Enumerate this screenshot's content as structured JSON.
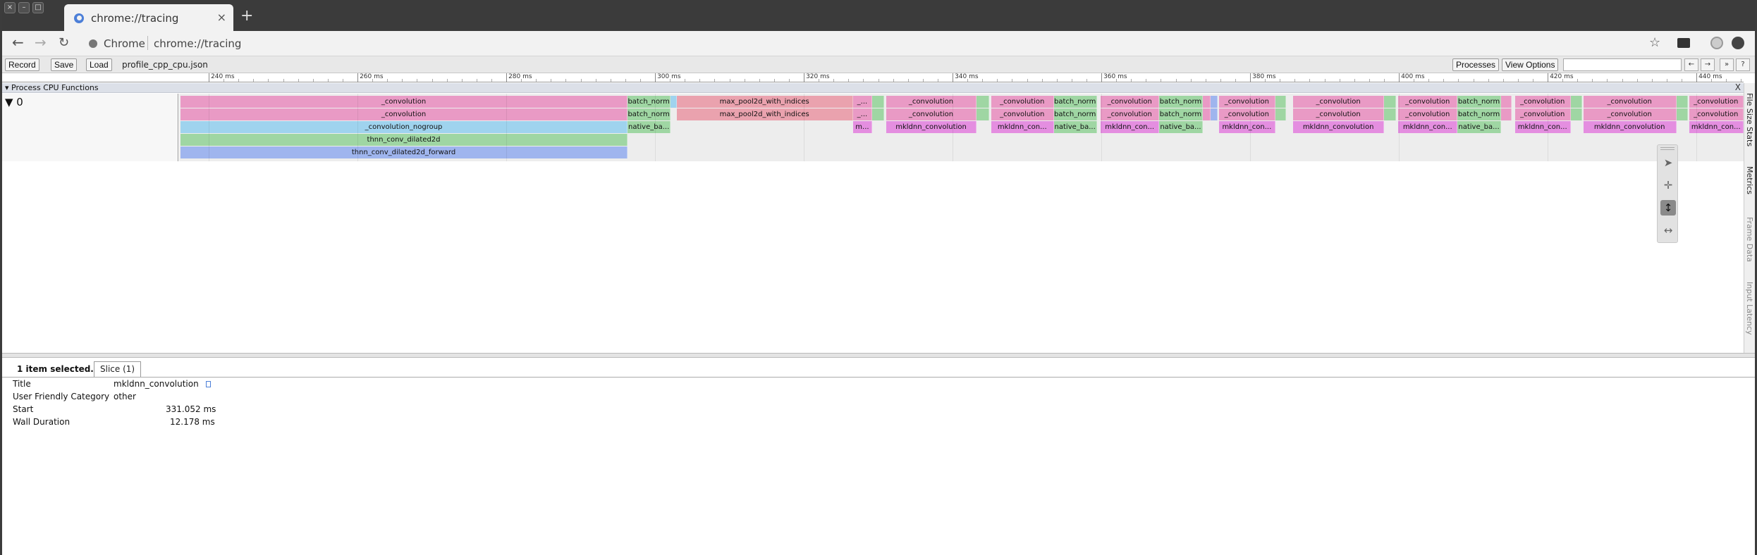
{
  "browser": {
    "tab_title": "chrome://tracing",
    "new_tab_label": "+",
    "tab_close_label": "×",
    "site_label": "Chrome",
    "url": "chrome://tracing",
    "window_buttons": [
      "×",
      "–",
      "□"
    ]
  },
  "toolbar": {
    "record": "Record",
    "save": "Save",
    "load": "Load",
    "filename": "profile_cpp_cpu.json",
    "processes": "Processes",
    "view_options": "View Options",
    "search_placeholder": "",
    "search_prev": "←",
    "search_next": "→",
    "search_all": "»",
    "help": "?"
  },
  "timeline": {
    "ticks": [
      "240 ms",
      "260 ms",
      "280 ms",
      "300 ms",
      "320 ms",
      "340 ms",
      "360 ms",
      "380 ms",
      "400 ms",
      "420 ms",
      "440 ms"
    ],
    "process_header": "▾ Process CPU Functions",
    "process_close": "X",
    "thread_label": "▼  0",
    "slices": [
      {
        "label": "_convolution",
        "start": 236.2,
        "end": 296.3,
        "row": 0,
        "color": "#e99ac5"
      },
      {
        "label": "_convolution",
        "start": 236.2,
        "end": 296.3,
        "row": 1,
        "color": "#e99ac5"
      },
      {
        "label": "_convolution_nogroup",
        "start": 236.2,
        "end": 296.3,
        "row": 2,
        "color": "#9fd3ee"
      },
      {
        "label": "thnn_conv_dilated2d",
        "start": 236.2,
        "end": 296.3,
        "row": 3,
        "color": "#9fd6a3"
      },
      {
        "label": "thnn_conv_dilated2d_forward",
        "start": 236.2,
        "end": 296.3,
        "row": 4,
        "color": "#9fb5ee"
      },
      {
        "label": "batch_norm",
        "start": 296.3,
        "end": 302.1,
        "row": 0,
        "color": "#9fd6a3"
      },
      {
        "label": "batch_norm",
        "start": 296.3,
        "end": 302.1,
        "row": 1,
        "color": "#9fd6a3"
      },
      {
        "label": "native_ba...",
        "start": 296.3,
        "end": 302.1,
        "row": 2,
        "color": "#9fd6a3"
      },
      {
        "label": "",
        "start": 302.1,
        "end": 302.9,
        "row": 0,
        "color": "#9fd3ee"
      },
      {
        "label": "max_pool2d_with_indices",
        "start": 302.9,
        "end": 326.6,
        "row": 0,
        "color": "#eaa2ae"
      },
      {
        "label": "max_pool2d_with_indices",
        "start": 302.9,
        "end": 326.6,
        "row": 1,
        "color": "#eaa2ae"
      },
      {
        "label": "_...",
        "start": 326.6,
        "end": 329.2,
        "row": 0,
        "color": "#e99ac5"
      },
      {
        "label": "_...",
        "start": 326.6,
        "end": 329.2,
        "row": 1,
        "color": "#e99ac5"
      },
      {
        "label": "m...",
        "start": 326.6,
        "end": 329.2,
        "row": 2,
        "color": "#e48ee0"
      },
      {
        "label": "",
        "start": 329.2,
        "end": 330.8,
        "row": 0,
        "color": "#9fd6a3"
      },
      {
        "label": "",
        "start": 329.2,
        "end": 330.8,
        "row": 1,
        "color": "#9fd6a3"
      },
      {
        "label": "_convolution",
        "start": 331.1,
        "end": 343.2,
        "row": 0,
        "color": "#e99ac5"
      },
      {
        "label": "_convolution",
        "start": 331.1,
        "end": 343.2,
        "row": 1,
        "color": "#e99ac5"
      },
      {
        "label": "mkldnn_convolution",
        "start": 331.1,
        "end": 343.2,
        "row": 2,
        "color": "#e48ee0"
      },
      {
        "label": "",
        "start": 343.2,
        "end": 344.9,
        "row": 0,
        "color": "#9fd6a3"
      },
      {
        "label": "",
        "start": 343.2,
        "end": 344.9,
        "row": 1,
        "color": "#9fd6a3"
      },
      {
        "label": "_convolution",
        "start": 345.2,
        "end": 353.6,
        "row": 0,
        "color": "#e99ac5"
      },
      {
        "label": "_convolution",
        "start": 345.2,
        "end": 353.6,
        "row": 1,
        "color": "#e99ac5"
      },
      {
        "label": "mkldnn_con...",
        "start": 345.2,
        "end": 353.6,
        "row": 2,
        "color": "#e48ee0"
      },
      {
        "label": "batch_norm",
        "start": 353.6,
        "end": 359.4,
        "row": 0,
        "color": "#9fd6a3"
      },
      {
        "label": "batch_norm",
        "start": 353.6,
        "end": 359.4,
        "row": 1,
        "color": "#9fd6a3"
      },
      {
        "label": "native_ba...",
        "start": 353.6,
        "end": 359.4,
        "row": 2,
        "color": "#9fd6a3"
      },
      {
        "label": "_convolution",
        "start": 359.9,
        "end": 367.8,
        "row": 0,
        "color": "#e99ac5"
      },
      {
        "label": "_convolution",
        "start": 359.9,
        "end": 367.8,
        "row": 1,
        "color": "#e99ac5"
      },
      {
        "label": "mkldnn_con...",
        "start": 359.9,
        "end": 367.8,
        "row": 2,
        "color": "#e48ee0"
      },
      {
        "label": "batch_norm",
        "start": 367.8,
        "end": 373.6,
        "row": 0,
        "color": "#9fd6a3"
      },
      {
        "label": "batch_norm",
        "start": 367.8,
        "end": 373.6,
        "row": 1,
        "color": "#9fd6a3"
      },
      {
        "label": "native_ba...",
        "start": 367.8,
        "end": 373.6,
        "row": 2,
        "color": "#9fd6a3"
      },
      {
        "label": "",
        "start": 373.6,
        "end": 374.7,
        "row": 0,
        "color": "#e99ac5"
      },
      {
        "label": "",
        "start": 373.6,
        "end": 374.7,
        "row": 1,
        "color": "#e99ac5"
      },
      {
        "label": "",
        "start": 374.7,
        "end": 375.6,
        "row": 0,
        "color": "#9fb5ee"
      },
      {
        "label": "",
        "start": 374.7,
        "end": 375.6,
        "row": 1,
        "color": "#9fb5ee"
      },
      {
        "label": "_convolution",
        "start": 375.8,
        "end": 383.4,
        "row": 0,
        "color": "#e99ac5"
      },
      {
        "label": "_convolution",
        "start": 375.8,
        "end": 383.4,
        "row": 1,
        "color": "#e99ac5"
      },
      {
        "label": "mkldnn_con...",
        "start": 375.8,
        "end": 383.4,
        "row": 2,
        "color": "#e48ee0"
      },
      {
        "label": "",
        "start": 383.4,
        "end": 384.8,
        "row": 0,
        "color": "#9fd6a3"
      },
      {
        "label": "",
        "start": 383.4,
        "end": 384.8,
        "row": 1,
        "color": "#9fd6a3"
      },
      {
        "label": "_convolution",
        "start": 385.8,
        "end": 398.0,
        "row": 0,
        "color": "#e99ac5"
      },
      {
        "label": "_convolution",
        "start": 385.8,
        "end": 398.0,
        "row": 1,
        "color": "#e99ac5"
      },
      {
        "label": "mkldnn_convolution",
        "start": 385.8,
        "end": 398.0,
        "row": 2,
        "color": "#e48ee0"
      },
      {
        "label": "",
        "start": 398.0,
        "end": 399.6,
        "row": 0,
        "color": "#9fd6a3"
      },
      {
        "label": "",
        "start": 398.0,
        "end": 399.6,
        "row": 1,
        "color": "#9fd6a3"
      },
      {
        "label": "_convolution",
        "start": 399.9,
        "end": 407.9,
        "row": 0,
        "color": "#e99ac5"
      },
      {
        "label": "_convolution",
        "start": 399.9,
        "end": 407.9,
        "row": 1,
        "color": "#e99ac5"
      },
      {
        "label": "mkldnn_con...",
        "start": 399.9,
        "end": 407.9,
        "row": 2,
        "color": "#e48ee0"
      },
      {
        "label": "batch_norm",
        "start": 407.9,
        "end": 413.7,
        "row": 0,
        "color": "#9fd6a3"
      },
      {
        "label": "batch_norm",
        "start": 407.9,
        "end": 413.7,
        "row": 1,
        "color": "#9fd6a3"
      },
      {
        "label": "native_ba...",
        "start": 407.9,
        "end": 413.7,
        "row": 2,
        "color": "#9fd6a3"
      },
      {
        "label": "",
        "start": 413.7,
        "end": 415.2,
        "row": 0,
        "color": "#e99ac5"
      },
      {
        "label": "",
        "start": 413.7,
        "end": 415.2,
        "row": 1,
        "color": "#e99ac5"
      },
      {
        "label": "_convolution",
        "start": 415.6,
        "end": 423.1,
        "row": 0,
        "color": "#e99ac5"
      },
      {
        "label": "_convolution",
        "start": 415.6,
        "end": 423.1,
        "row": 1,
        "color": "#e99ac5"
      },
      {
        "label": "mkldnn_con...",
        "start": 415.6,
        "end": 423.1,
        "row": 2,
        "color": "#e48ee0"
      },
      {
        "label": "",
        "start": 423.1,
        "end": 424.6,
        "row": 0,
        "color": "#9fd6a3"
      },
      {
        "label": "",
        "start": 423.1,
        "end": 424.6,
        "row": 1,
        "color": "#9fd6a3"
      },
      {
        "label": "_convolution",
        "start": 424.8,
        "end": 437.3,
        "row": 0,
        "color": "#e99ac5"
      },
      {
        "label": "_convolution",
        "start": 424.8,
        "end": 437.3,
        "row": 1,
        "color": "#e99ac5"
      },
      {
        "label": "mkldnn_convolution",
        "start": 424.8,
        "end": 437.3,
        "row": 2,
        "color": "#e48ee0"
      },
      {
        "label": "",
        "start": 437.3,
        "end": 438.9,
        "row": 0,
        "color": "#9fd6a3"
      },
      {
        "label": "",
        "start": 437.3,
        "end": 438.9,
        "row": 1,
        "color": "#9fd6a3"
      },
      {
        "label": "_convolution",
        "start": 439.0,
        "end": 446.5,
        "row": 0,
        "color": "#e99ac5"
      },
      {
        "label": "_convolution",
        "start": 439.0,
        "end": 446.5,
        "row": 1,
        "color": "#e99ac5"
      },
      {
        "label": "mkldnn_con...",
        "start": 439.0,
        "end": 446.5,
        "row": 2,
        "color": "#e48ee0"
      }
    ]
  },
  "side_panel": {
    "tabs": [
      "File Size Stats",
      "Metrics",
      "Frame Data",
      "Input Latency"
    ]
  },
  "mouse_modes": [
    "select-icon",
    "pan-icon",
    "zoom-icon",
    "timing-icon"
  ],
  "analysis": {
    "selected_count": "1 item selected.",
    "tab_label": "Slice (1)",
    "rows": [
      {
        "key": "Title",
        "value": "mkldnn_convolution"
      },
      {
        "key": "User Friendly Category",
        "value": "other"
      },
      {
        "key": "Start",
        "value": "331.052 ms"
      },
      {
        "key": "Wall Duration",
        "value": "12.178 ms"
      }
    ]
  }
}
